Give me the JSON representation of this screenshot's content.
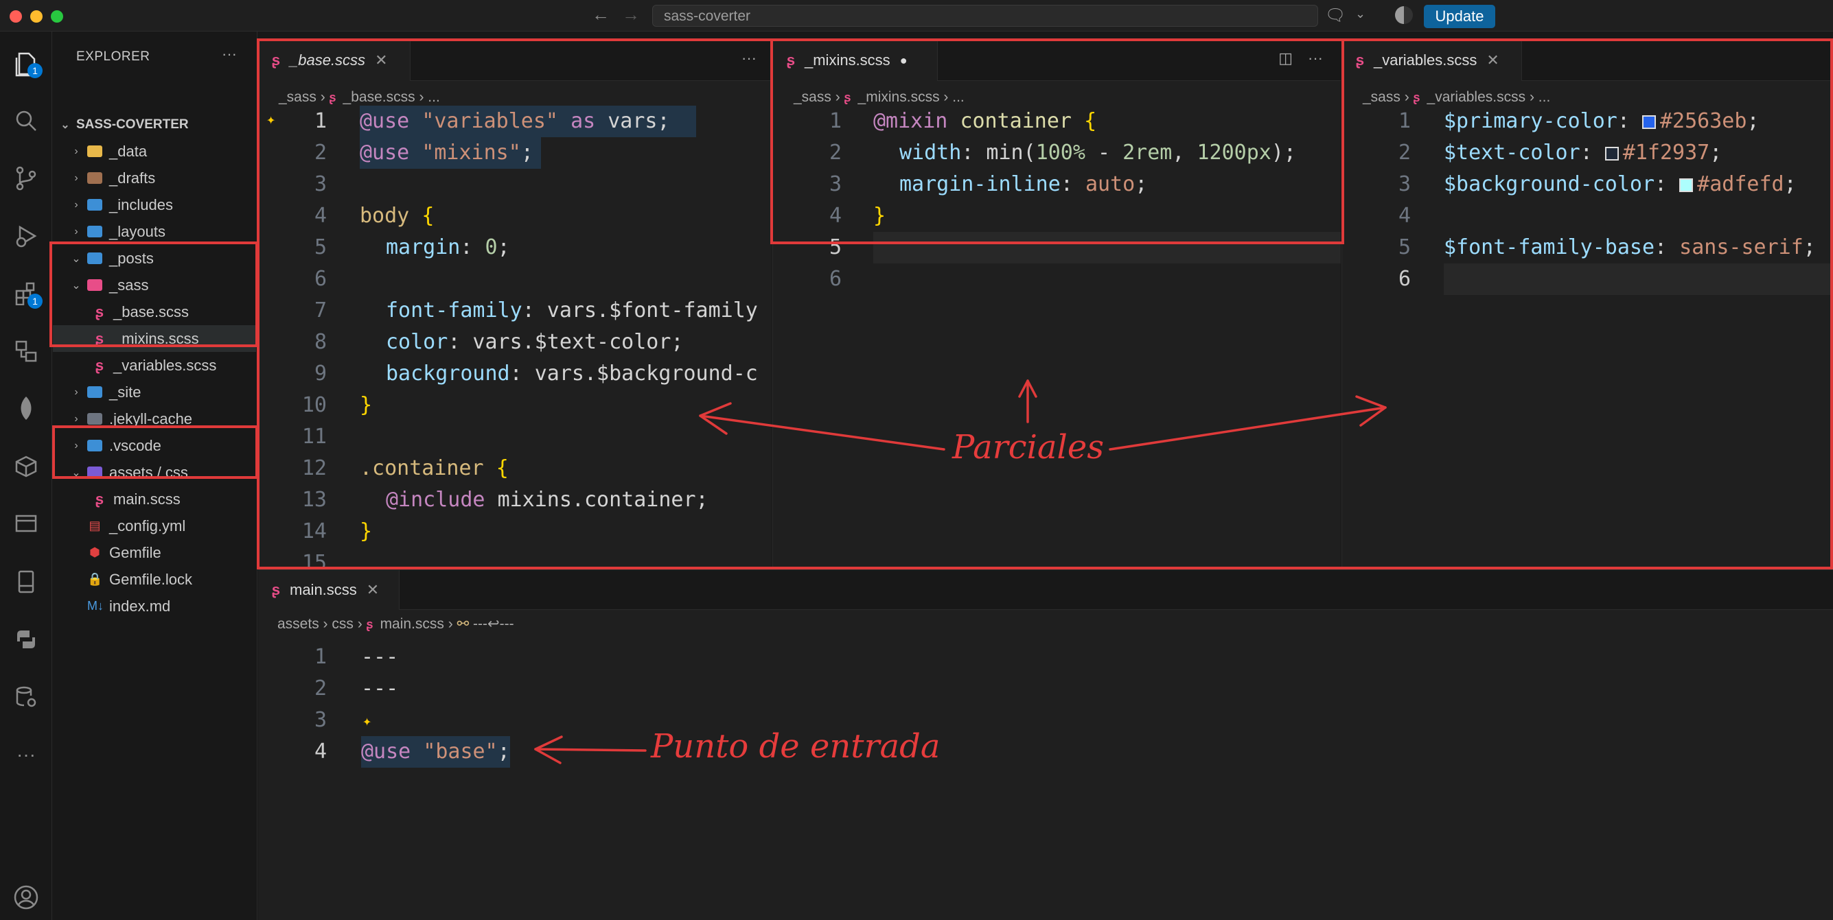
{
  "titlebar": {
    "search_text": "sass-coverter",
    "update_label": "Update"
  },
  "activity_badges": {
    "explorer": "1",
    "extensions": "1"
  },
  "explorer": {
    "title": "EXPLORER",
    "more": "···",
    "root": "SASS-COVERTER",
    "items": [
      {
        "label": "_data"
      },
      {
        "label": "_drafts"
      },
      {
        "label": "_includes"
      },
      {
        "label": "_layouts"
      },
      {
        "label": "_posts"
      },
      {
        "label": "_sass"
      },
      {
        "label": "_base.scss"
      },
      {
        "label": "_mixins.scss"
      },
      {
        "label": "_variables.scss"
      },
      {
        "label": "_site"
      },
      {
        "label": ".jekyll-cache"
      },
      {
        "label": ".vscode"
      },
      {
        "label": "assets / css"
      },
      {
        "label": "main.scss"
      },
      {
        "label": "_config.yml"
      },
      {
        "label": "Gemfile"
      },
      {
        "label": "Gemfile.lock"
      },
      {
        "label": "index.md"
      }
    ]
  },
  "editor_base": {
    "tab": "_base.scss",
    "crumb_dir": "_sass",
    "crumb_file": "_base.scss",
    "crumb_more": "...",
    "lines": [
      "1",
      "2",
      "3",
      "4",
      "5",
      "6",
      "7",
      "8",
      "9",
      "10",
      "11",
      "12",
      "13",
      "14",
      "15"
    ],
    "code": {
      "l1a": "@use",
      "l1b": "\"variables\"",
      "l1c": "as",
      "l1d": "vars;",
      "l2a": "@use",
      "l2b": "\"mixins\"",
      "l2c": ";",
      "l4a": "body",
      "l4b": "{",
      "l5a": "margin",
      "l5b": ": ",
      "l5c": "0",
      ";": ";",
      "l7a": "font-family",
      "l7b": ": vars.$font-family",
      "l8a": "color",
      "l8b": ": vars.$text-color;",
      "l9a": "background",
      "l9b": ": vars.$background-c",
      "l10": "}",
      "l12a": ".container",
      "l12b": "{",
      "l13a": "@include",
      "l13b": "mixins.container;",
      "l14": "}"
    }
  },
  "editor_mixins": {
    "tab": "_mixins.scss",
    "crumb_dir": "_sass",
    "crumb_file": "_mixins.scss",
    "crumb_more": "...",
    "lines": [
      "1",
      "2",
      "3",
      "4",
      "5",
      "6"
    ],
    "code": {
      "l1a": "@mixin",
      "l1b": "container",
      "l1c": "{",
      "l2a": "width",
      "l2b": ": min(",
      "l2c": "100%",
      "l2d": " - ",
      "l2e": "2rem",
      "l2f": ", ",
      "l2g": "1200px",
      "l2h": ");",
      "l3a": "margin-inline",
      "l3b": ": ",
      "l3c": "auto",
      ";": ";",
      "l4": "}"
    }
  },
  "editor_vars": {
    "tab": "_variables.scss",
    "crumb_dir": "_sass",
    "crumb_file": "_variables.scss",
    "crumb_more": "...",
    "lines": [
      "1",
      "2",
      "3",
      "4",
      "5",
      "6"
    ],
    "code": {
      "l1a": "$primary-color",
      "l1c": "#2563eb",
      "l1d": ";",
      "l2a": "$text-color",
      "l2c": "#1f2937",
      "l2d": ";",
      "l3a": "$background-color",
      "l3c": "#adfefd",
      "l3d": ";",
      "l5a": "$font-family-base",
      "l5c": "sans-serif",
      "l5d": ";"
    }
  },
  "editor_main": {
    "tab": "main.scss",
    "crumb_a": "assets",
    "crumb_b": "css",
    "crumb_c": "main.scss",
    "crumb_d": "---↩---",
    "lines": [
      "1",
      "2",
      "3",
      "4"
    ],
    "code": {
      "l1": "---",
      "l2": "---",
      "l4a": "@use",
      "l4b": "\"base\"",
      "l4c": ";"
    }
  },
  "annotations": {
    "partials": "Parciales",
    "entry": "Punto de entrada"
  },
  "colors": {
    "primary": "#2563eb",
    "text": "#1f2937",
    "background": "#adfefd",
    "annotation": "#e03a3a"
  }
}
